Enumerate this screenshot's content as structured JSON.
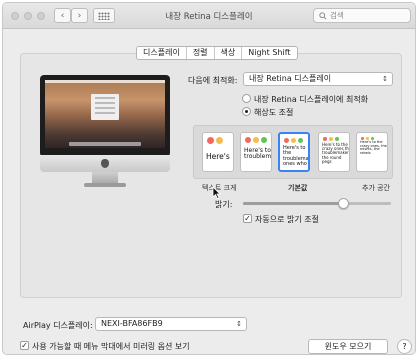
{
  "window": {
    "title": "내장 Retina 디스플레이",
    "search_placeholder": "검색",
    "back_icon": "chevron-left-icon",
    "forward_icon": "chevron-right-icon",
    "grid_icon": "grid-icon"
  },
  "tabs": [
    {
      "label": "디스플레이",
      "active": true
    },
    {
      "label": "정렬",
      "active": false
    },
    {
      "label": "색상",
      "active": false
    },
    {
      "label": "Night Shift",
      "active": false
    }
  ],
  "optimize": {
    "label": "다음에 최적화:",
    "value": "내장 Retina 디스플레이"
  },
  "resolution": {
    "options": [
      {
        "label": "내장 Retina 디스플레이에 최적화",
        "selected": false
      },
      {
        "label": "해상도 조절",
        "selected": true
      }
    ],
    "thumb_text": [
      "Here's",
      "Here's to troublem",
      "Here's to the troublemake ones who",
      "Here's to the crazy ones the troublemakers. the round pegs",
      "Here's to the crazy ones, the misfits, the rebels"
    ],
    "scale_labels": {
      "left": "텍스트 크게",
      "center": "기본값",
      "right": "추가 공간"
    },
    "selected_index": 2
  },
  "brightness": {
    "label": "밝기:",
    "level": 0.68,
    "auto_label": "자동으로 밝기 조절",
    "auto_checked": true
  },
  "airplay": {
    "label": "AirPlay 디스플레이:",
    "value": "NEXI-BFA86FB9"
  },
  "footer": {
    "mirroring_label": "사용 가능할 때 메뉴 막대에서 미러링 옵션 보기",
    "mirroring_checked": true,
    "gather_button": "윈도우 모으기",
    "help": "?"
  },
  "colors": {
    "accent": "#3b82f6",
    "red": "#ee6a5f",
    "yellow": "#f5bd4f",
    "green": "#61c454"
  }
}
